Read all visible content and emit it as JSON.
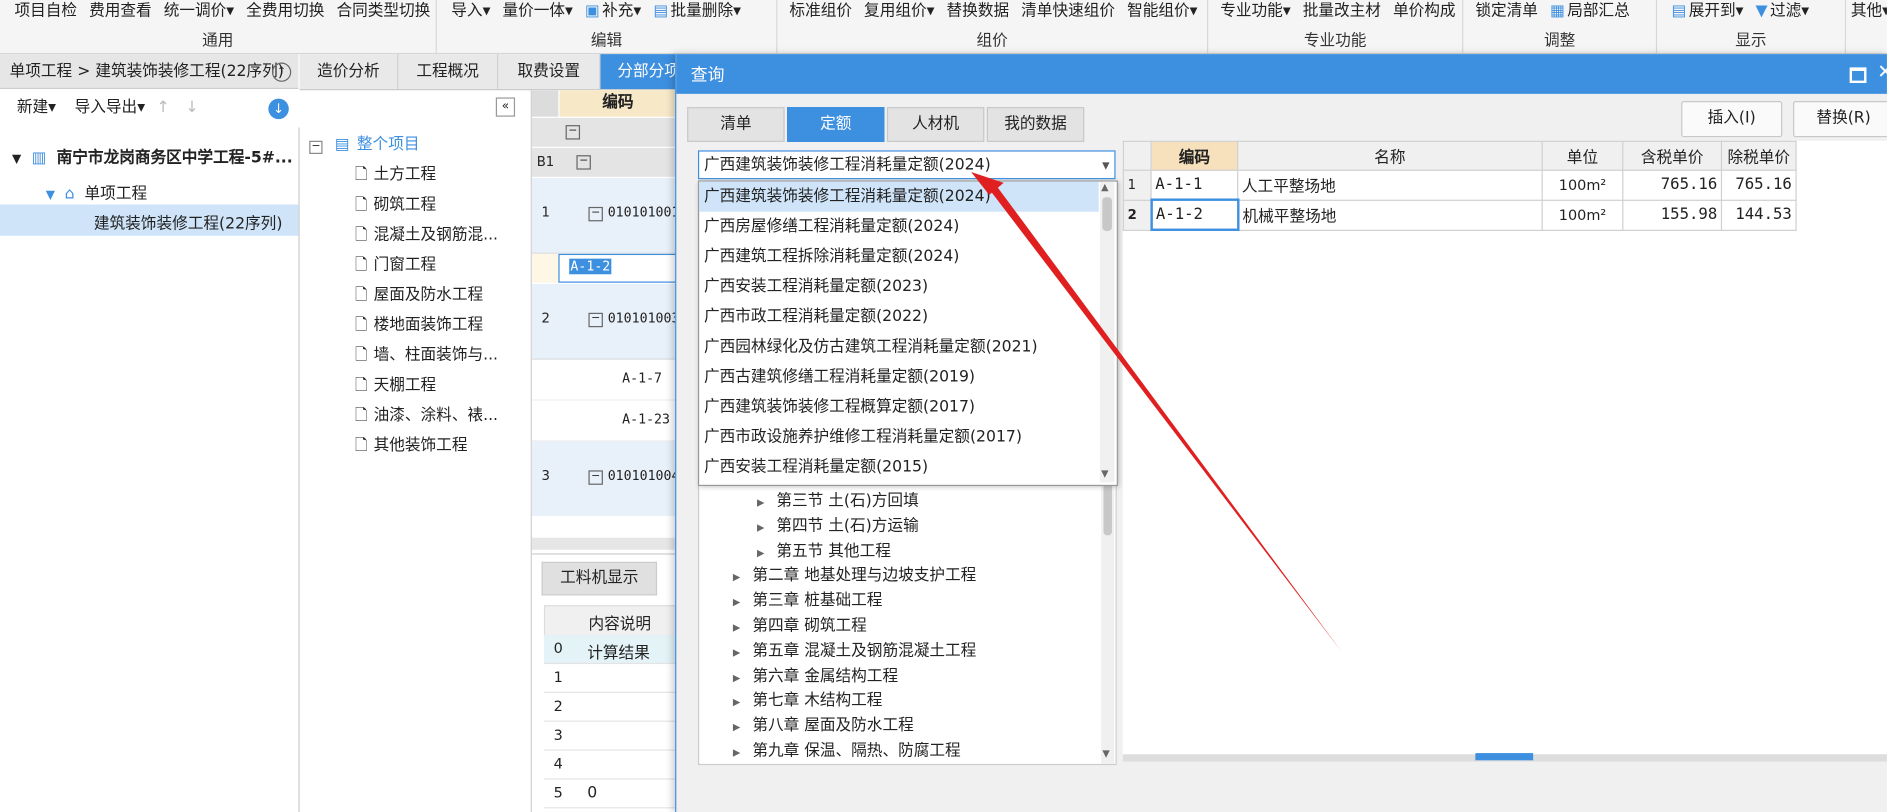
{
  "ribbon": {
    "groups": [
      {
        "items": [
          "项目自检",
          "费用查看",
          "统一调价▾",
          "全费用切换",
          "合同类型切换"
        ],
        "label": "通用"
      },
      {
        "items": [
          "导入▾",
          "量价一体▾",
          "补充▾",
          "批量删除▾"
        ],
        "label": "编辑"
      },
      {
        "items": [
          "标准组价",
          "复用组价▾",
          "替换数据",
          "清单快速组价",
          "智能组价▾"
        ],
        "label": "组价"
      },
      {
        "items": [
          "专业功能▾",
          "批量改主材",
          "单价构成"
        ],
        "label": "专业功能"
      },
      {
        "items": [
          "锁定清单",
          "局部汇总"
        ],
        "label": "调整"
      },
      {
        "items": [
          "展开到▾",
          "过滤▾"
        ],
        "label": "显示"
      },
      {
        "items": [
          "其他▾"
        ],
        "label": ""
      }
    ]
  },
  "breadcrumb": {
    "part1": "单项工程",
    "sep": ">",
    "part2": "建筑装饰装修工程(22序列)"
  },
  "left_toolbar": {
    "new_label": "新建▾",
    "import_export_label": "导入导出▾"
  },
  "project_tree": {
    "root": "南宁市龙岗商务区中学工程-5#...",
    "child": "单项工程",
    "selected": "建筑装饰装修工程(22序列)"
  },
  "nav_tabs": [
    "造价分析",
    "工程概况",
    "取费设置",
    "分部分项"
  ],
  "division_tree": {
    "root": "整个项目",
    "items": [
      "土方工程",
      "砌筑工程",
      "混凝土及钢筋混...",
      "门窗工程",
      "屋面及防水工程",
      "楼地面装饰工程",
      "墙、柱面装饰与...",
      "天棚工程",
      "油漆、涂料、裱...",
      "其他装饰工程"
    ]
  },
  "main_grid": {
    "header_code": "编码",
    "b1": "B1",
    "rows": [
      {
        "num": "1",
        "code": "010101001"
      },
      {
        "num": "",
        "code": "A-1-2"
      },
      {
        "num": "2",
        "code": "010101003"
      },
      {
        "num": "",
        "code": "A-1-7"
      },
      {
        "num": "",
        "code": "A-1-23"
      },
      {
        "num": "3",
        "code": "010101004"
      }
    ]
  },
  "bottom_panel": {
    "tab": "工料机显示",
    "header": "内容说明",
    "rows": [
      {
        "num": "0",
        "text": "计算结果"
      },
      {
        "num": "1",
        "text": ""
      },
      {
        "num": "2",
        "text": ""
      },
      {
        "num": "3",
        "text": ""
      },
      {
        "num": "4",
        "text": ""
      },
      {
        "num": "5",
        "text": "0"
      }
    ],
    "row5_value": "0"
  },
  "dialog": {
    "title": "查询",
    "tabs": [
      "清单",
      "定额",
      "人材机",
      "我的数据"
    ],
    "active_tab": 1,
    "insert_button": "插入(I)",
    "replace_button": "替换(R)",
    "quota_select": "广西建筑装饰装修工程消耗量定额(2024)",
    "dropdown_options": [
      "广西建筑装饰装修工程消耗量定额(2024)",
      "广西房屋修缮工程消耗量定额(2024)",
      "广西建筑工程拆除消耗量定额(2024)",
      "广西安装工程消耗量定额(2023)",
      "广西市政工程消耗量定额(2022)",
      "广西园林绿化及仿古建筑工程消耗量定额(2021)",
      "广西古建筑修缮工程消耗量定额(2019)",
      "广西建筑装饰装修工程概算定额(2017)",
      "广西市政设施养护维修工程消耗量定额(2017)",
      "广西安装工程消耗量定额(2015)"
    ],
    "sections": [
      "第三节 土(石)方回填",
      "第四节 土(石)方运输",
      "第五节 其他工程"
    ],
    "chapters": [
      "第二章 地基处理与边坡支护工程",
      "第三章 桩基础工程",
      "第四章 砌筑工程",
      "第五章 混凝土及钢筋混凝土工程",
      "第六章 金属结构工程",
      "第七章 木结构工程",
      "第八章 屋面及防水工程",
      "第九章 保温、隔热、防腐工程"
    ],
    "result_table": {
      "headers": [
        "编码",
        "名称",
        "单位",
        "含税单价",
        "除税单价"
      ],
      "rows": [
        {
          "num": "1",
          "code": "A-1-1",
          "name": "人工平整场地",
          "unit": "100m²",
          "price_tax": "765.16",
          "price_notax": "765.16"
        },
        {
          "num": "2",
          "code": "A-1-2",
          "name": "机械平整场地",
          "unit": "100m²",
          "price_tax": "155.98",
          "price_notax": "144.53"
        }
      ]
    }
  },
  "colors": {
    "accent": "#3d8fe0",
    "selected_row": "#cfe4f8",
    "arrow": "#e02020"
  }
}
